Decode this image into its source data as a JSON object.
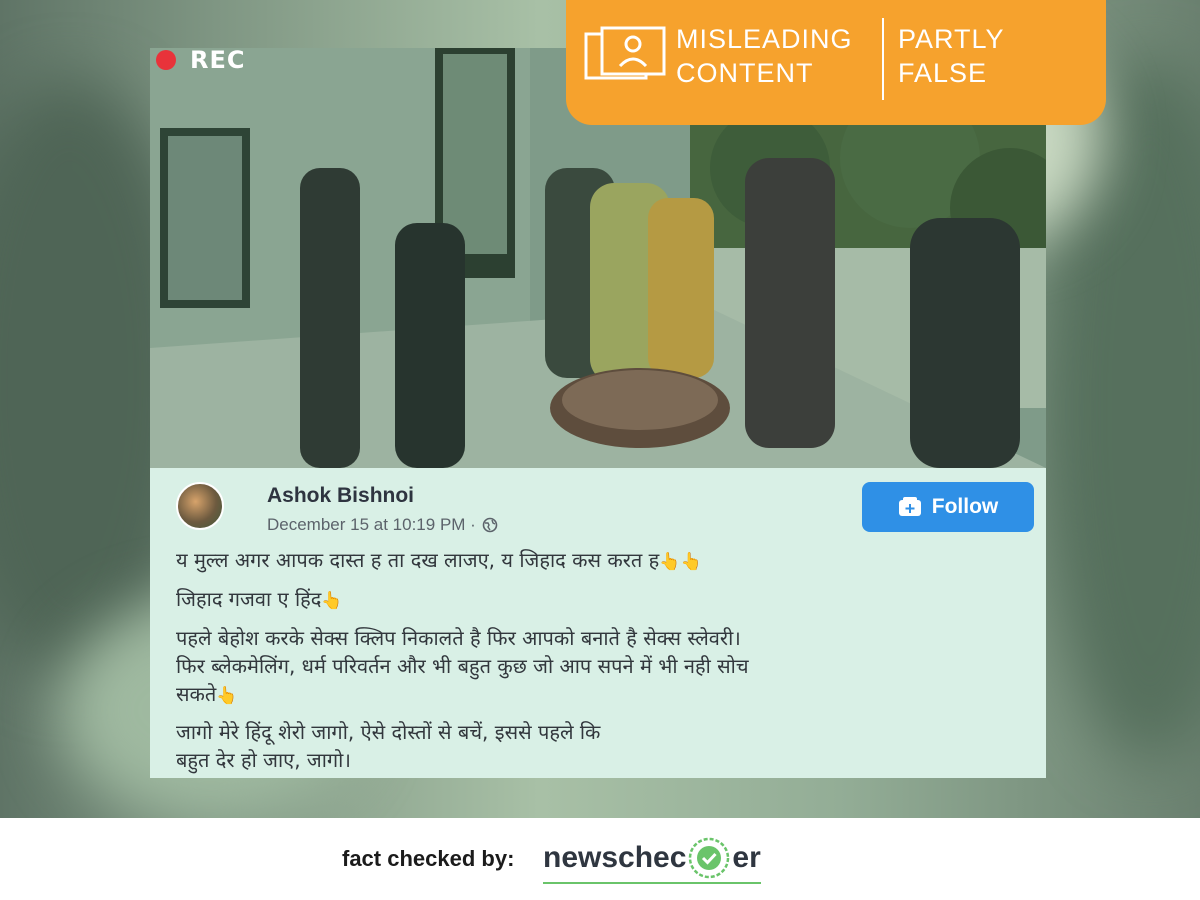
{
  "badge": {
    "left_text": "MISLEADING\nCONTENT",
    "right_text": "PARTLY\nFALSE",
    "icon": "photo-frame-person-icon",
    "color": "#f6a22d"
  },
  "video": {
    "rec_label": "REC",
    "rec_icon": "record-dot-icon"
  },
  "post": {
    "author": "Ashok Bishnoi",
    "timestamp": "December 15 at 10:19 PM · ",
    "privacy_icon": "globe-icon",
    "follow_label": "Follow",
    "follow_icon": "add-friend-icon",
    "lines": [
      "य मुल्ल अगर आपक दास्त ह ता दख लाजए, य जिहाद कस करत ह",
      "जिहाद गजवा ए हिंद",
      "पहले बेहोश करके सेक्स क्लिप निकालते है फिर आपको बनाते है सेक्स स्लेवरी।",
      "फिर ब्लेकमेलिंग, धर्म परिवर्तन और भी बहुत कुछ जो आप सपने में भी नही सोच",
      "सकते",
      "जागो मेरे हिंदू शेरो जागो, ऐसे दोस्तों से बचें, इससे पहले कि",
      "बहुत देर हो जाए, जागो।"
    ],
    "emoji": "👆"
  },
  "footer": {
    "label": "fact checked by:",
    "brand_left": "newschec",
    "brand_right": "er",
    "check_icon": "check-circle-icon",
    "brand_color": "#6ac46a"
  }
}
